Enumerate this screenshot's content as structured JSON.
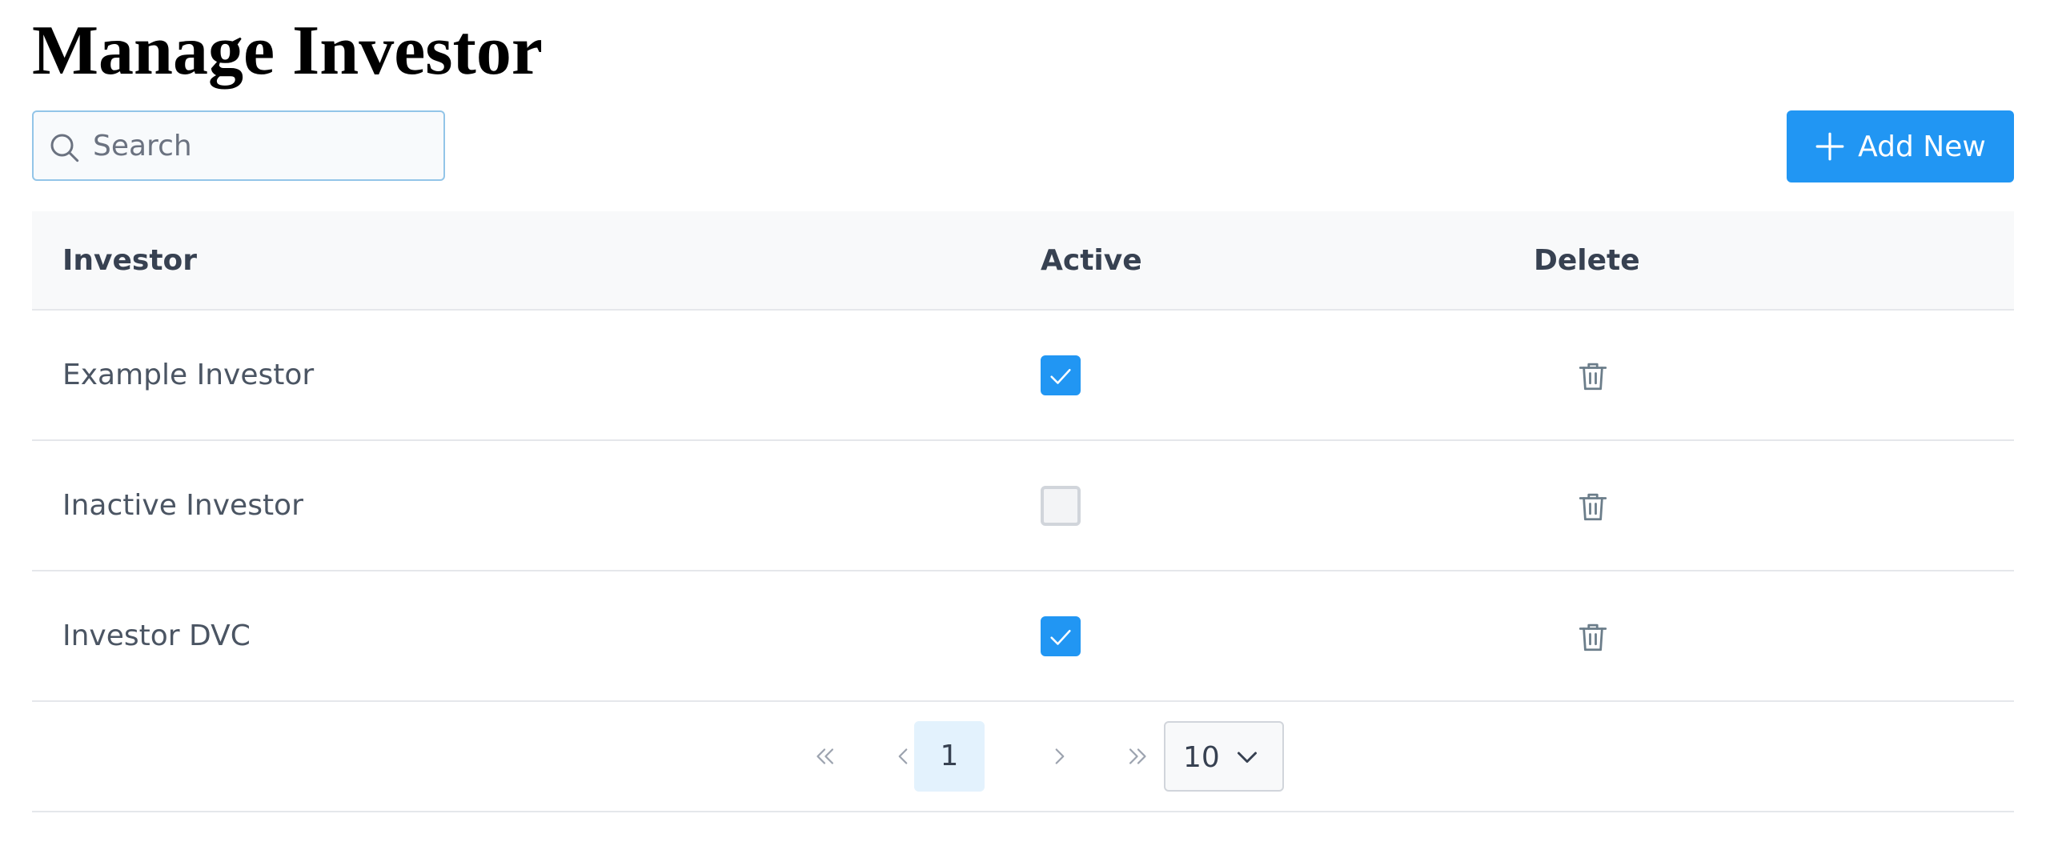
{
  "page": {
    "title": "Manage Investor"
  },
  "toolbar": {
    "search_placeholder": "Search",
    "search_value": "",
    "add_label": "Add New"
  },
  "table": {
    "columns": [
      "Investor",
      "Active",
      "Delete"
    ],
    "rows": [
      {
        "investor": "Example Investor",
        "active": true
      },
      {
        "investor": "Inactive Investor",
        "active": false
      },
      {
        "investor": "Investor DVC",
        "active": true
      }
    ]
  },
  "pagination": {
    "current_page": "1",
    "page_size": "10"
  },
  "colors": {
    "accent": "#2196f3",
    "current_page_bg": "#e3f2fd",
    "icon_gray": "#6b7d8a"
  },
  "icons": {
    "search": "search-icon",
    "add": "plus-icon",
    "check": "check-icon",
    "delete": "trash-icon",
    "first": "chevrons-left-icon",
    "prev": "chevron-left-icon",
    "next": "chevron-right-icon",
    "last": "chevrons-right-icon",
    "page_size": "chevron-down-icon"
  }
}
